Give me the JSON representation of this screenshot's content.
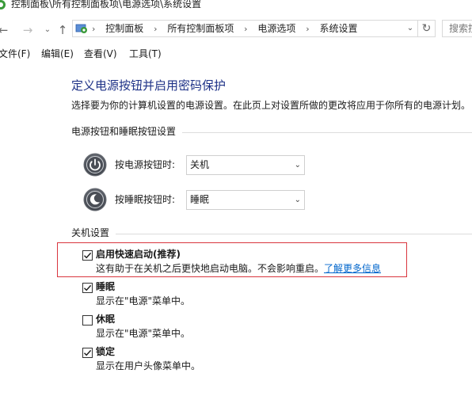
{
  "window": {
    "title": "控制面板\\所有控制面板项\\电源选项\\系统设置"
  },
  "nav": {
    "back_icon": "arrow-left-icon",
    "forward_icon": "arrow-right-icon",
    "recent_icon": "chevron-down-icon",
    "up_icon": "arrow-up-icon",
    "breadcrumbs": [
      "控制面板",
      "所有控制面板项",
      "电源选项",
      "系统设置"
    ],
    "search_placeholder": "搜索控制"
  },
  "menu": {
    "items": [
      "文件(F)",
      "编辑(E)",
      "查看(V)",
      "工具(T)"
    ]
  },
  "page": {
    "title": "定义电源按钮并启用密码保护",
    "description": "选择要为你的计算机设置的电源设置。在此页上对设置所做的更改将应用于你所有的电源计划。"
  },
  "buttons_section": {
    "heading": "电源按钮和睡眠按钮设置",
    "power_label": "按电源按钮时:",
    "power_value": "关机",
    "sleep_label": "按睡眠按钮时:",
    "sleep_value": "睡眠"
  },
  "shutdown_section": {
    "heading": "关机设置",
    "items": [
      {
        "title": "启用快速启动(推荐)",
        "desc": "这有助于在关机之后更快地启动电脑。不会影响重启。",
        "link": "了解更多信息",
        "checked": true
      },
      {
        "title": "睡眠",
        "desc": "显示在\"电源\"菜单中。",
        "checked": true
      },
      {
        "title": "休眠",
        "desc": "显示在\"电源\"菜单中。",
        "checked": false
      },
      {
        "title": "锁定",
        "desc": "显示在用户头像菜单中。",
        "checked": true
      }
    ]
  },
  "colors": {
    "title_blue": "#1e3287",
    "link_blue": "#0066cc",
    "highlight_red": "#d9363e"
  }
}
